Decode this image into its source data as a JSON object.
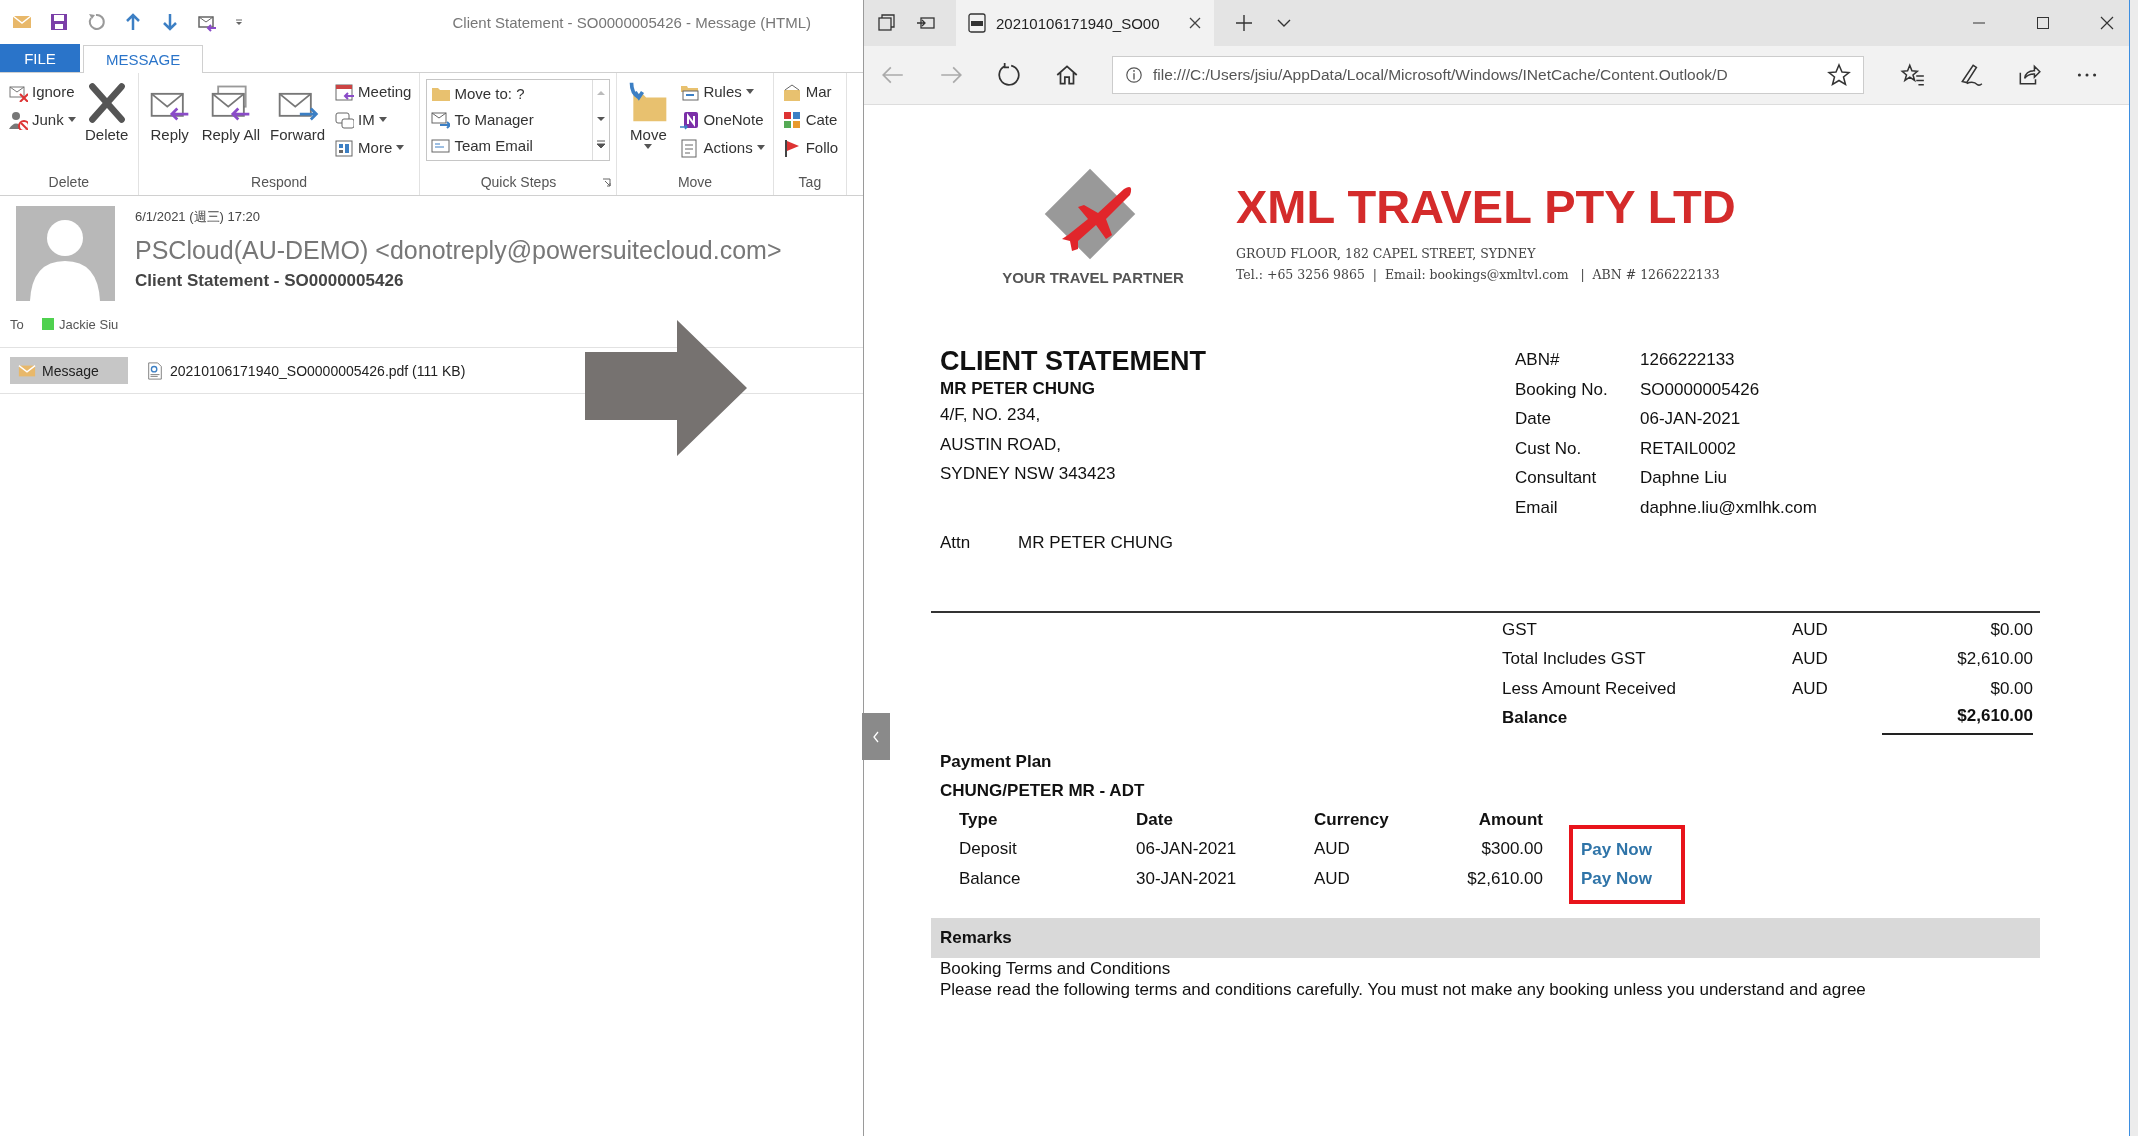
{
  "outlook": {
    "window_title": "Client Statement - SO0000005426 - Message (HTML)",
    "tabs": [
      {
        "label": "FILE",
        "kind": "file",
        "selected": false
      },
      {
        "label": "MESSAGE",
        "kind": "tab",
        "selected": true
      }
    ],
    "ribbon_groups": [
      {
        "label": "Delete",
        "launcher": false,
        "controls": [
          {
            "kind": "stack",
            "items": [
              {
                "label": "Ignore",
                "dropdown": false
              },
              {
                "label": "Junk",
                "dropdown": true
              }
            ]
          },
          {
            "kind": "large",
            "label": "Delete",
            "dropdown": false
          }
        ]
      },
      {
        "label": "Respond",
        "launcher": false,
        "controls": [
          {
            "kind": "large",
            "label": "Reply",
            "dropdown": false
          },
          {
            "kind": "large",
            "label": "Reply All",
            "dropdown": false
          },
          {
            "kind": "large",
            "label": "Forward",
            "dropdown": false
          },
          {
            "kind": "stack",
            "items": [
              {
                "label": "Meeting",
                "dropdown": false
              },
              {
                "label": "IM",
                "dropdown": true
              },
              {
                "label": "More",
                "dropdown": true
              }
            ]
          }
        ]
      },
      {
        "label": "Quick Steps",
        "launcher": true,
        "controls": [
          {
            "kind": "gallery",
            "items": [
              {
                "label": "Move to: ?"
              },
              {
                "label": "To Manager"
              },
              {
                "label": "Team Email"
              }
            ]
          }
        ]
      },
      {
        "label": "Move",
        "launcher": false,
        "controls": [
          {
            "kind": "large",
            "label": "Move",
            "dropdown": true
          },
          {
            "kind": "stack",
            "items": [
              {
                "label": "Rules",
                "dropdown": true
              },
              {
                "label": "OneNote",
                "dropdown": false
              },
              {
                "label": "Actions",
                "dropdown": true
              }
            ]
          }
        ]
      },
      {
        "label": "Tag",
        "launcher": false,
        "controls": [
          {
            "kind": "stack",
            "items": [
              {
                "label": "Mar",
                "dropdown": false
              },
              {
                "label": "Cate",
                "dropdown": false
              },
              {
                "label": "Follo",
                "dropdown": false
              }
            ]
          }
        ]
      }
    ],
    "message": {
      "date": "6/1/2021 (週三) 17:20",
      "sender": "PSCloud(AU-DEMO) <donotreply@powersuitecloud.com>",
      "subject": "Client Statement - SO0000005426",
      "to_label": "To",
      "recipients": [
        {
          "name": "Jackie Siu",
          "color": "#4fd14f"
        }
      ],
      "attachments": [
        {
          "label": "Message",
          "kind": "message",
          "selected": true
        },
        {
          "label": "20210106171940_SO0000005426.pdf (111 KB)",
          "kind": "pdf",
          "selected": false
        }
      ]
    }
  },
  "browser": {
    "tab_title": "20210106171940_SO00",
    "address": "file:///C:/Users/jsiu/AppData/Local/Microsoft/Windows/INetCache/Content.Outlook/D",
    "document": {
      "company": {
        "tagline": "YOUR TRAVEL PARTNER",
        "name": "XML TRAVEL PTY LTD",
        "address": "GROUD FLOOR, 182 CAPEL STREET, SYDNEY",
        "contact": "Tel.: +65 3256 9865  |  Email: bookings@xmltvl.com   |  ABN # 1266222133"
      },
      "title": "CLIENT STATEMENT",
      "client_name": "MR PETER CHUNG",
      "client_address": [
        "4/F, NO. 234,",
        "AUSTIN ROAD,",
        "SYDNEY NSW 343423"
      ],
      "attn": {
        "label": "Attn",
        "value": "MR PETER CHUNG"
      },
      "details": [
        {
          "label": "ABN#",
          "value": "1266222133"
        },
        {
          "label": "Booking No.",
          "value": "SO0000005426"
        },
        {
          "label": "Date",
          "value": "06-JAN-2021"
        },
        {
          "label": "Cust No.",
          "value": "RETAIL0002"
        },
        {
          "label": "Consultant",
          "value": "Daphne Liu"
        },
        {
          "label": "Email",
          "value": "daphne.liu@xmlhk.com"
        }
      ],
      "totals": [
        {
          "label": "GST",
          "currency": "AUD",
          "amount": "$0.00",
          "kind": "line"
        },
        {
          "label": "Total Includes GST",
          "currency": "AUD",
          "amount": "$2,610.00",
          "kind": "line"
        },
        {
          "label": "Less Amount Received",
          "currency": "AUD",
          "amount": "$0.00",
          "kind": "line"
        },
        {
          "label": "Balance",
          "amount": "$2,610.00",
          "kind": "total"
        }
      ],
      "payment_plan": {
        "title": "Payment Plan",
        "passenger": "CHUNG/PETER MR - ADT",
        "columns": [
          "Type",
          "Date",
          "Currency",
          "Amount"
        ],
        "rows": [
          {
            "type": "Deposit",
            "date": "06-JAN-2021",
            "currency": "AUD",
            "amount": "$300.00",
            "action": "Pay Now"
          },
          {
            "type": "Balance",
            "date": "30-JAN-2021",
            "currency": "AUD",
            "amount": "$2,610.00",
            "action": "Pay Now"
          }
        ],
        "actions_highlighted": true
      },
      "remarks": {
        "title": "Remarks",
        "lines": [
          "Booking Terms and Conditions",
          "Please read the following terms and conditions carefully.  You must not make any booking unless you understand and agree"
        ]
      }
    }
  }
}
